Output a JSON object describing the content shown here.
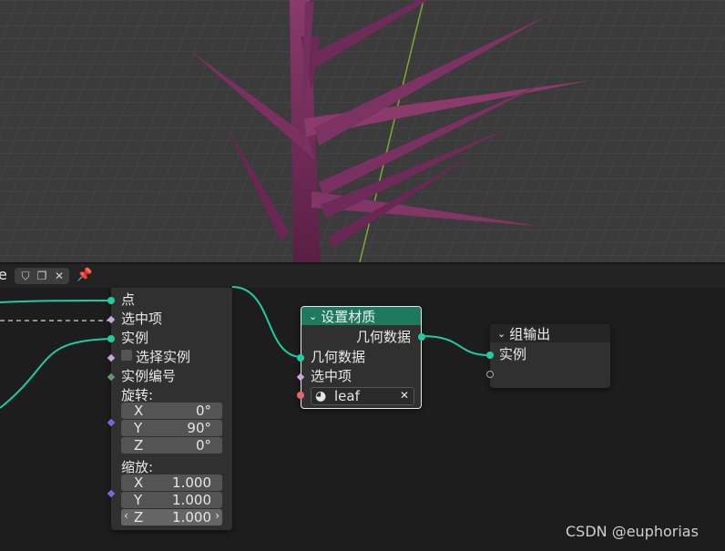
{
  "editor_header": {
    "name_fragment": "e"
  },
  "instance_node": {
    "inputs": {
      "points": "点",
      "selection": "选中项",
      "instance": "实例",
      "pick_instance": "选择实例",
      "instance_index": "实例编号"
    },
    "rotation": {
      "label": "旋转:",
      "x_axis": "X",
      "x_value": "0°",
      "y_axis": "Y",
      "y_value": "90°",
      "z_axis": "Z",
      "z_value": "0°"
    },
    "scale": {
      "label": "缩放:",
      "x_axis": "X",
      "x_value": "1.000",
      "y_axis": "Y",
      "y_value": "1.000",
      "z_axis": "Z",
      "z_value": "1.000"
    }
  },
  "set_material_node": {
    "title": "设置材质",
    "output_geometry": "几何数据",
    "input_geometry": "几何数据",
    "input_selection": "选中项",
    "material": "leaf",
    "header_color": "#1e7a5e"
  },
  "group_output_node": {
    "title": "组输出",
    "input_instance": "实例"
  },
  "socket_color": "#1fcda0",
  "watermark": "CSDN @euphorias"
}
